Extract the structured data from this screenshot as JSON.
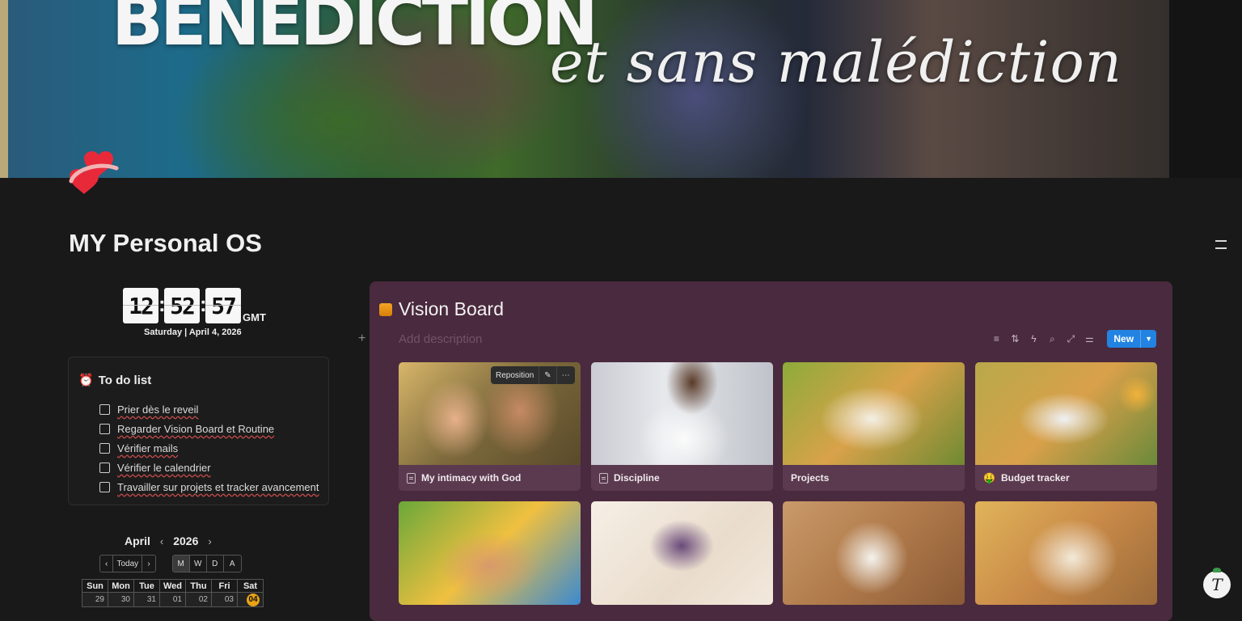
{
  "cover": {
    "title_line1": "BENEDICTION",
    "title_line2": "et sans malédiction"
  },
  "page": {
    "title": "MY Personal OS"
  },
  "clock": {
    "hours": "12",
    "minutes": "52",
    "seconds": "57",
    "timezone": "GMT",
    "date": "Saturday | April 4, 2026"
  },
  "todo": {
    "icon": "alarm-clock-icon",
    "title": "To do list",
    "items": [
      {
        "label": "Prier dès  le reveil",
        "checked": false
      },
      {
        "label": "Regarder Vision Board et Routine",
        "checked": false
      },
      {
        "label": "Vérifier mails",
        "checked": false
      },
      {
        "label": "Vérifier le calendrier",
        "checked": false
      },
      {
        "label": "Travailler sur projets et tracker avancement",
        "checked": false
      }
    ]
  },
  "calendar": {
    "month": "April",
    "year": "2026",
    "today_label": "Today",
    "views": [
      "M",
      "W",
      "D",
      "A"
    ],
    "active_view": "M",
    "weekdays": [
      "Sun",
      "Mon",
      "Tue",
      "Wed",
      "Thu",
      "Fri",
      "Sat"
    ],
    "first_week": [
      "29",
      "30",
      "31",
      "01",
      "02",
      "03",
      "04"
    ],
    "today_day": "04"
  },
  "vision_board": {
    "title": "Vision Board",
    "description_placeholder": "Add description",
    "new_label": "New",
    "reposition_label": "Reposition",
    "accent_color": "#2383e2",
    "background_color": "#4a2a3e",
    "cards": [
      {
        "title": "My intimacy with God",
        "icon": "page-icon"
      },
      {
        "title": "Discipline",
        "icon": "page-icon"
      },
      {
        "title": "Projects",
        "icon": ""
      },
      {
        "title": "Budget tracker",
        "icon": "money-face-icon"
      }
    ]
  }
}
